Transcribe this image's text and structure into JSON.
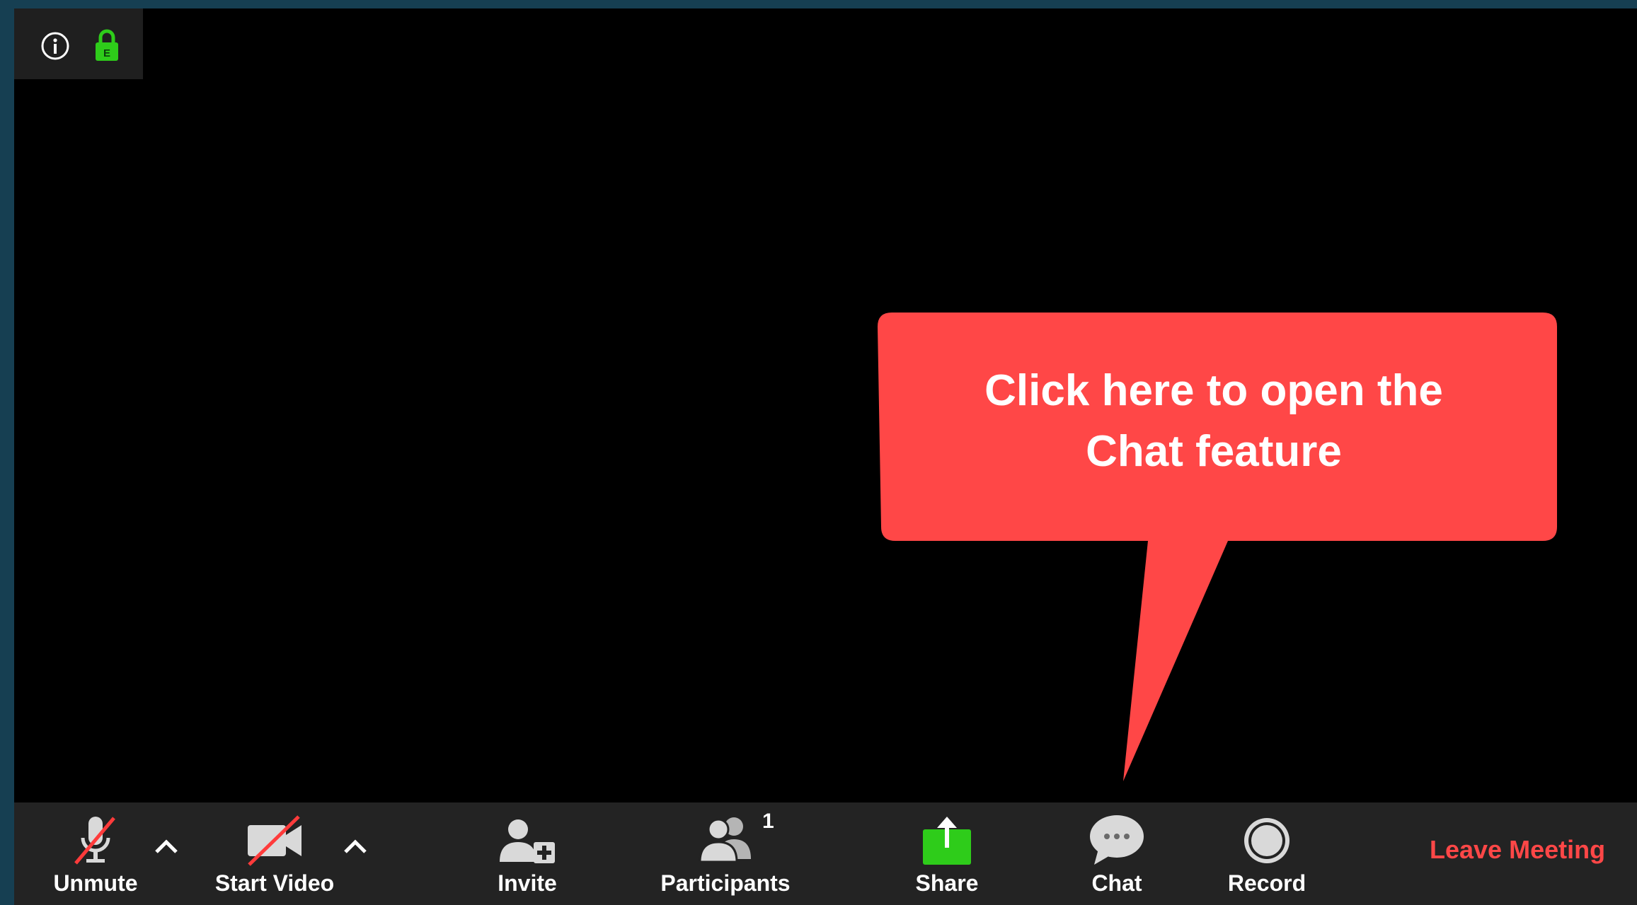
{
  "top_bar": {
    "info_icon": "info-icon",
    "lock_icon": "lock-icon",
    "lock_badge": "E",
    "lock_color": "#2ecc1a"
  },
  "callout": {
    "line1": "Click here to open the",
    "line2": "Chat feature",
    "color": "#ff4747"
  },
  "toolbar": {
    "unmute_label": "Unmute",
    "start_video_label": "Start Video",
    "invite_label": "Invite",
    "participants_label": "Participants",
    "participants_count": "1",
    "share_label": "Share",
    "chat_label": "Chat",
    "record_label": "Record",
    "leave_label": "Leave Meeting",
    "share_color": "#2ecc1a",
    "leave_color": "#ff4747",
    "icons": [
      "microphone-muted-icon",
      "caret-up-icon",
      "video-off-icon",
      "caret-up-icon",
      "invite-user-icon",
      "participants-icon",
      "share-screen-icon",
      "chat-bubble-icon",
      "record-icon"
    ]
  }
}
